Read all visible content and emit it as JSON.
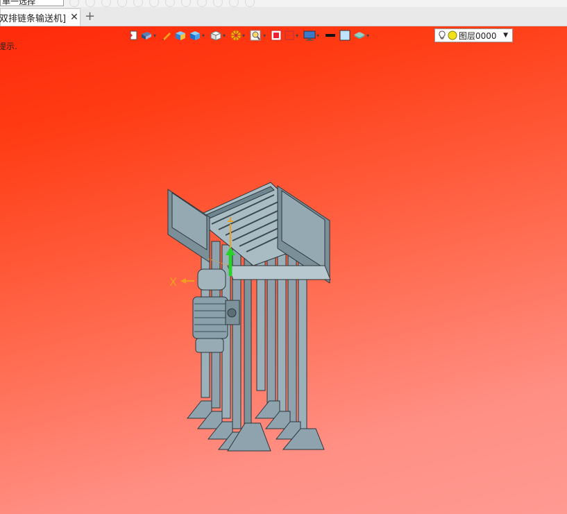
{
  "toolbar_top": {
    "selection_mode": "单一选择"
  },
  "tabs": {
    "document_label": "双排链条输送机]",
    "close_glyph": "✕",
    "new_glyph": "+"
  },
  "viewport": {
    "hint": "提示.",
    "axis_label": "X",
    "background_colors": [
      "#ff2a0a",
      "#ff9a92"
    ]
  },
  "view_toolbar": {
    "buttons": [
      "view-fit-icon",
      "camera-view-icon",
      "pen-icon",
      "shaded-cube-icon",
      "blue-cube-icon",
      "white-cube-icon",
      "section-icon",
      "zoom-icon",
      "red-box-icon",
      "clip-icon",
      "display-icon",
      "line-color-icon",
      "fill-color-icon",
      "layer-stack-icon"
    ],
    "layer": {
      "name": "图层0000",
      "bulb_icon": "lightbulb-icon",
      "state_icon": "yellow-circle-icon"
    }
  },
  "colors": {
    "model_steel": "#8ea3ad",
    "model_dark": "#4a5a62",
    "accent_green": "#2bd12b",
    "accent_orange": "#f0a020"
  }
}
